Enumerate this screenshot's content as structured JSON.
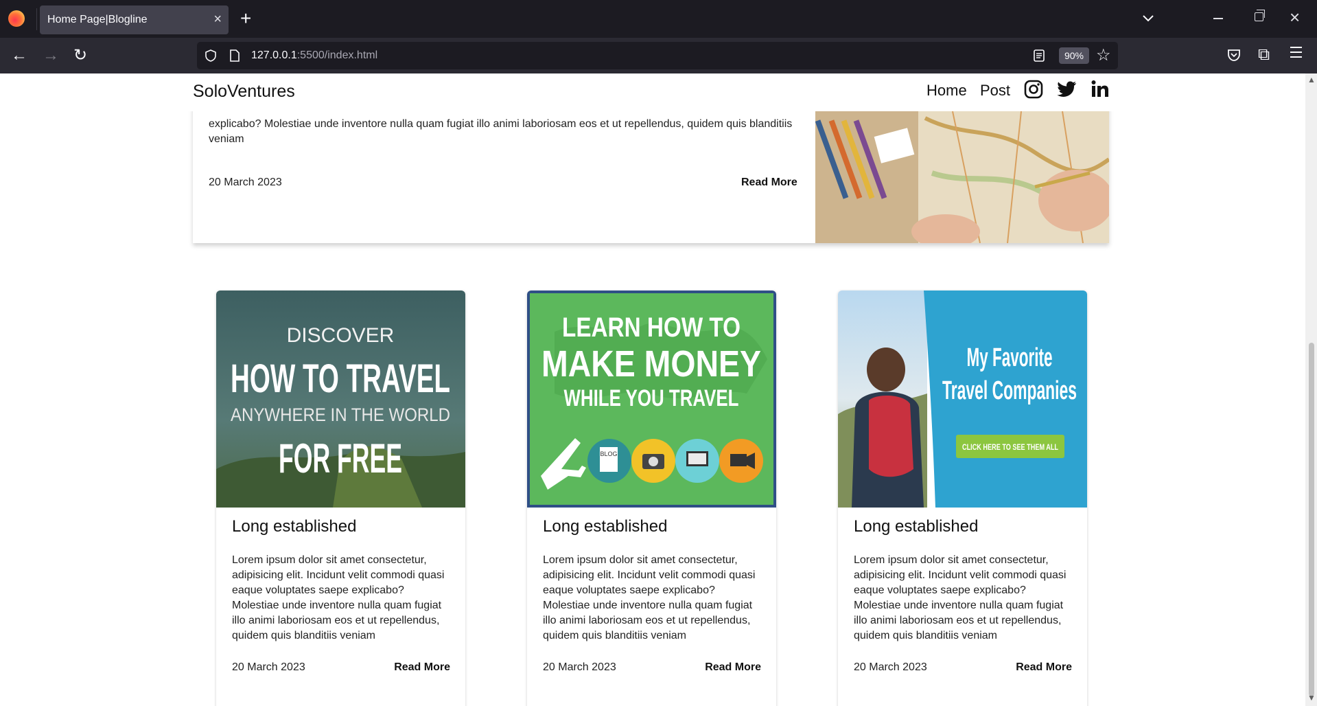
{
  "browser": {
    "tab_title": "Home Page|Blogline",
    "tab_close": "×",
    "new_tab": "+",
    "url_host": "127.0.0.1",
    "url_rest": ":5500/index.html",
    "zoom": "90%"
  },
  "site": {
    "brand": "SoloVentures",
    "nav": {
      "home": "Home",
      "post": "Post"
    }
  },
  "featured": {
    "text": "explicabo? Molestiae unde inventore nulla quam fugiat illo animi laboriosam eos et ut repellendus, quidem quis blanditiis veniam",
    "date": "20 March 2023",
    "read_more": "Read More"
  },
  "cards": [
    {
      "image_lines": [
        "DISCOVER",
        "HOW TO TRAVEL",
        "ANYWHERE IN THE WORLD",
        "FOR FREE"
      ],
      "title": "Long established",
      "text": "Lorem ipsum dolor sit amet consectetur, adipisicing elit. Incidunt velit commodi quasi eaque voluptates saepe explicabo? Molestiae unde inventore nulla quam fugiat illo animi laboriosam eos et ut repellendus, quidem quis blanditiis veniam",
      "date": "20 March 2023",
      "read_more": "Read More"
    },
    {
      "image_lines": [
        "LEARN HOW TO",
        "MAKE MONEY",
        "WHILE YOU TRAVEL",
        "BLOG"
      ],
      "title": "Long established",
      "text": "Lorem ipsum dolor sit amet consectetur, adipisicing elit. Incidunt velit commodi quasi eaque voluptates saepe explicabo? Molestiae unde inventore nulla quam fugiat illo animi laboriosam eos et ut repellendus, quidem quis blanditiis veniam",
      "date": "20 March 2023",
      "read_more": "Read More"
    },
    {
      "image_lines": [
        "My Favorite",
        "Travel Companies",
        "CLICK HERE TO SEE THEM ALL"
      ],
      "title": "Long established",
      "text": "Lorem ipsum dolor sit amet consectetur, adipisicing elit. Incidunt velit commodi quasi eaque voluptates saepe explicabo? Molestiae unde inventore nulla quam fugiat illo animi laboriosam eos et ut repellendus, quidem quis blanditiis veniam",
      "date": "20 March 2023",
      "read_more": "Read More"
    }
  ],
  "colors": {
    "chrome_dark": "#1c1b22",
    "chrome_toolbar": "#2b2a33",
    "card1_bg": "#3f6a6b",
    "card2_bg": "#5cb85c",
    "card3_bg": "#2ea3d0",
    "card3_button": "#8cc63f"
  }
}
